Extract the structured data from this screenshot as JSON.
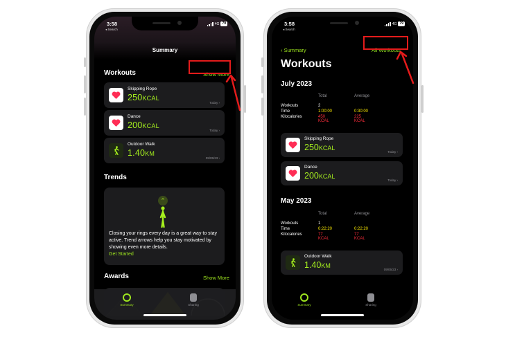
{
  "colors": {
    "accent_green": "#9ee51f",
    "value_green": "#a6f01e",
    "annotation_red": "#e41b1b",
    "time_yellow": "#f5e400",
    "kcal_red": "#ff2d3b"
  },
  "left_phone": {
    "status": {
      "time": "3:58",
      "back": "◂ Search",
      "network": "4G",
      "battery": "79"
    },
    "nav_title": "Summary",
    "workouts": {
      "title": "Workouts",
      "show_more": "Show More",
      "items": [
        {
          "name": "Skipping Rope",
          "value": "250",
          "unit": "KCAL",
          "date": "Today ›",
          "icon": "heart-icon"
        },
        {
          "name": "Dance",
          "value": "200",
          "unit": "KCAL",
          "date": "Today ›",
          "icon": "heart-icon"
        },
        {
          "name": "Outdoor Walk",
          "value": "1.40",
          "unit": "KM",
          "date": "09/05/23 ›",
          "icon": "walk-icon"
        }
      ]
    },
    "trends": {
      "title": "Trends",
      "description": "Closing your rings every day is a great way to stay active. Trend arrows help you stay motivated by showing even more details.",
      "get_started": "Get Started"
    },
    "awards": {
      "title": "Awards",
      "show_more": "Show More"
    },
    "tabbar": {
      "summary": "Summary",
      "sharing": "Sharing"
    }
  },
  "right_phone": {
    "status": {
      "time": "3:58",
      "back": "◂ Search",
      "network": "4G",
      "battery": "79"
    },
    "back_link": "‹ Summary",
    "all_workouts": "All Workouts",
    "title": "Workouts",
    "july": {
      "month": "July 2023",
      "headers": {
        "total": "Total",
        "average": "Average"
      },
      "rows": [
        {
          "label": "Workouts",
          "total": "2",
          "average": ""
        },
        {
          "label": "Time",
          "total": "1:00:00",
          "average": "0:30:00"
        },
        {
          "label": "Kilocalories",
          "total": "450 KCAL",
          "average": "225 KCAL"
        }
      ],
      "items": [
        {
          "name": "Skipping Rope",
          "value": "250",
          "unit": "KCAL",
          "date": "Today ›",
          "icon": "heart-icon"
        },
        {
          "name": "Dance",
          "value": "200",
          "unit": "KCAL",
          "date": "Today ›",
          "icon": "heart-icon"
        }
      ]
    },
    "may": {
      "month": "May 2023",
      "headers": {
        "total": "Total",
        "average": "Average"
      },
      "rows": [
        {
          "label": "Workouts",
          "total": "1",
          "average": ""
        },
        {
          "label": "Time",
          "total": "0:22:20",
          "average": "0:22:20"
        },
        {
          "label": "Kilocalories",
          "total": "77 KCAL",
          "average": "77 KCAL"
        }
      ],
      "items": [
        {
          "name": "Outdoor Walk",
          "value": "1.40",
          "unit": "KM",
          "date": "09/05/23 ›",
          "icon": "walk-icon"
        }
      ]
    },
    "tabbar": {
      "summary": "Summary",
      "sharing": "Sharing"
    }
  }
}
